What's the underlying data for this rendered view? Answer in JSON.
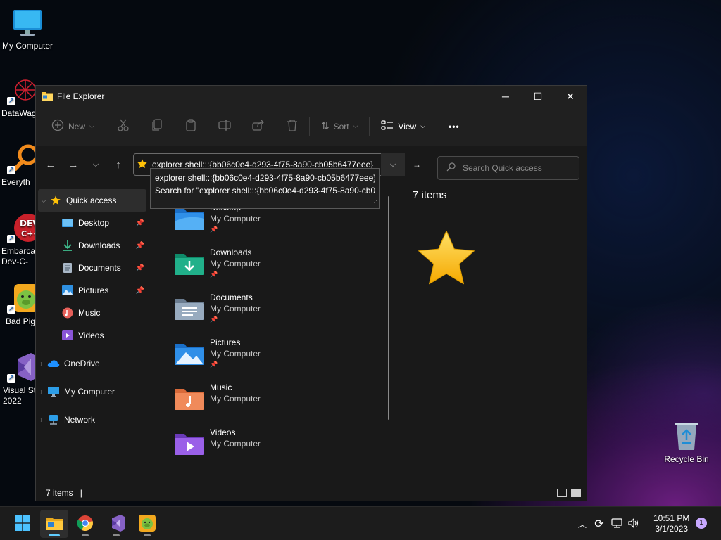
{
  "desktop": {
    "icons": [
      {
        "label": "My Computer"
      },
      {
        "label": "DataWag"
      },
      {
        "label": "Everyth"
      },
      {
        "label": "Embarca Dev-C-"
      },
      {
        "label": "Bad Pig"
      },
      {
        "label": "Visual St 2022"
      },
      {
        "label": "Recycle Bin"
      }
    ]
  },
  "window": {
    "title": "File Explorer",
    "controls": {
      "minimize": "─",
      "maximize": "☐",
      "close": "✕"
    }
  },
  "commandbar": {
    "new_label": "New",
    "sort_label": "Sort",
    "view_label": "View",
    "more_label": "•••"
  },
  "address": {
    "value": "explorer shell:::{bb06c0e4-d293-4f75-8a90-cb05b6477eee}",
    "suggestions": [
      "explorer shell:::{bb06c0e4-d293-4f75-8a90-cb05b6477eee}",
      "Search for \"explorer shell:::{bb06c0e4-d293-4f75-8a90-cb05b6477eee}\""
    ]
  },
  "search": {
    "placeholder": "Search Quick access"
  },
  "navpane": {
    "quick_access": "Quick access",
    "items": [
      {
        "label": "Desktop",
        "pinned": true
      },
      {
        "label": "Downloads",
        "pinned": true
      },
      {
        "label": "Documents",
        "pinned": true
      },
      {
        "label": "Pictures",
        "pinned": true
      },
      {
        "label": "Music",
        "pinned": false
      },
      {
        "label": "Videos",
        "pinned": false
      }
    ],
    "onedrive": "OneDrive",
    "mycomputer": "My Computer",
    "network": "Network"
  },
  "files": [
    {
      "name": "Desktop",
      "location": "My Computer",
      "pinned": true
    },
    {
      "name": "Downloads",
      "location": "My Computer",
      "pinned": true
    },
    {
      "name": "Documents",
      "location": "My Computer",
      "pinned": true
    },
    {
      "name": "Pictures",
      "location": "My Computer",
      "pinned": true
    },
    {
      "name": "Music",
      "location": "My Computer",
      "pinned": false
    },
    {
      "name": "Videos",
      "location": "My Computer",
      "pinned": false
    }
  ],
  "details": {
    "count": "7 items"
  },
  "status": {
    "count": "7 items",
    "caret": "|"
  },
  "taskbar": {
    "clock_time": "10:51 PM",
    "clock_date": "3/1/2023",
    "notifications": "1"
  },
  "colors": {
    "accent": "#60cdff",
    "folder": "#ffc83d",
    "star": "#ffc107"
  }
}
